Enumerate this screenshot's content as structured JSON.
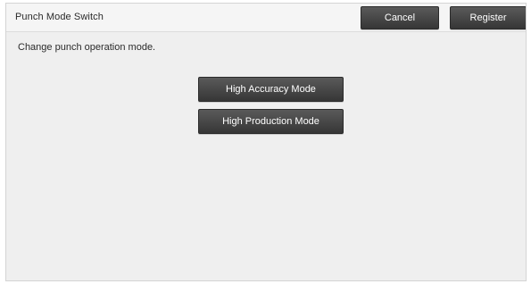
{
  "header": {
    "title": "Punch Mode Switch",
    "cancel_label": "Cancel",
    "register_label": "Register"
  },
  "main": {
    "description": "Change punch operation mode.",
    "modes": [
      {
        "label": "High Accuracy Mode"
      },
      {
        "label": "High Production Mode"
      }
    ]
  },
  "colors": {
    "button_top": "#5a5a5a",
    "button_bottom": "#363636",
    "panel_background": "#efefef",
    "text": "#2a2a2a"
  }
}
